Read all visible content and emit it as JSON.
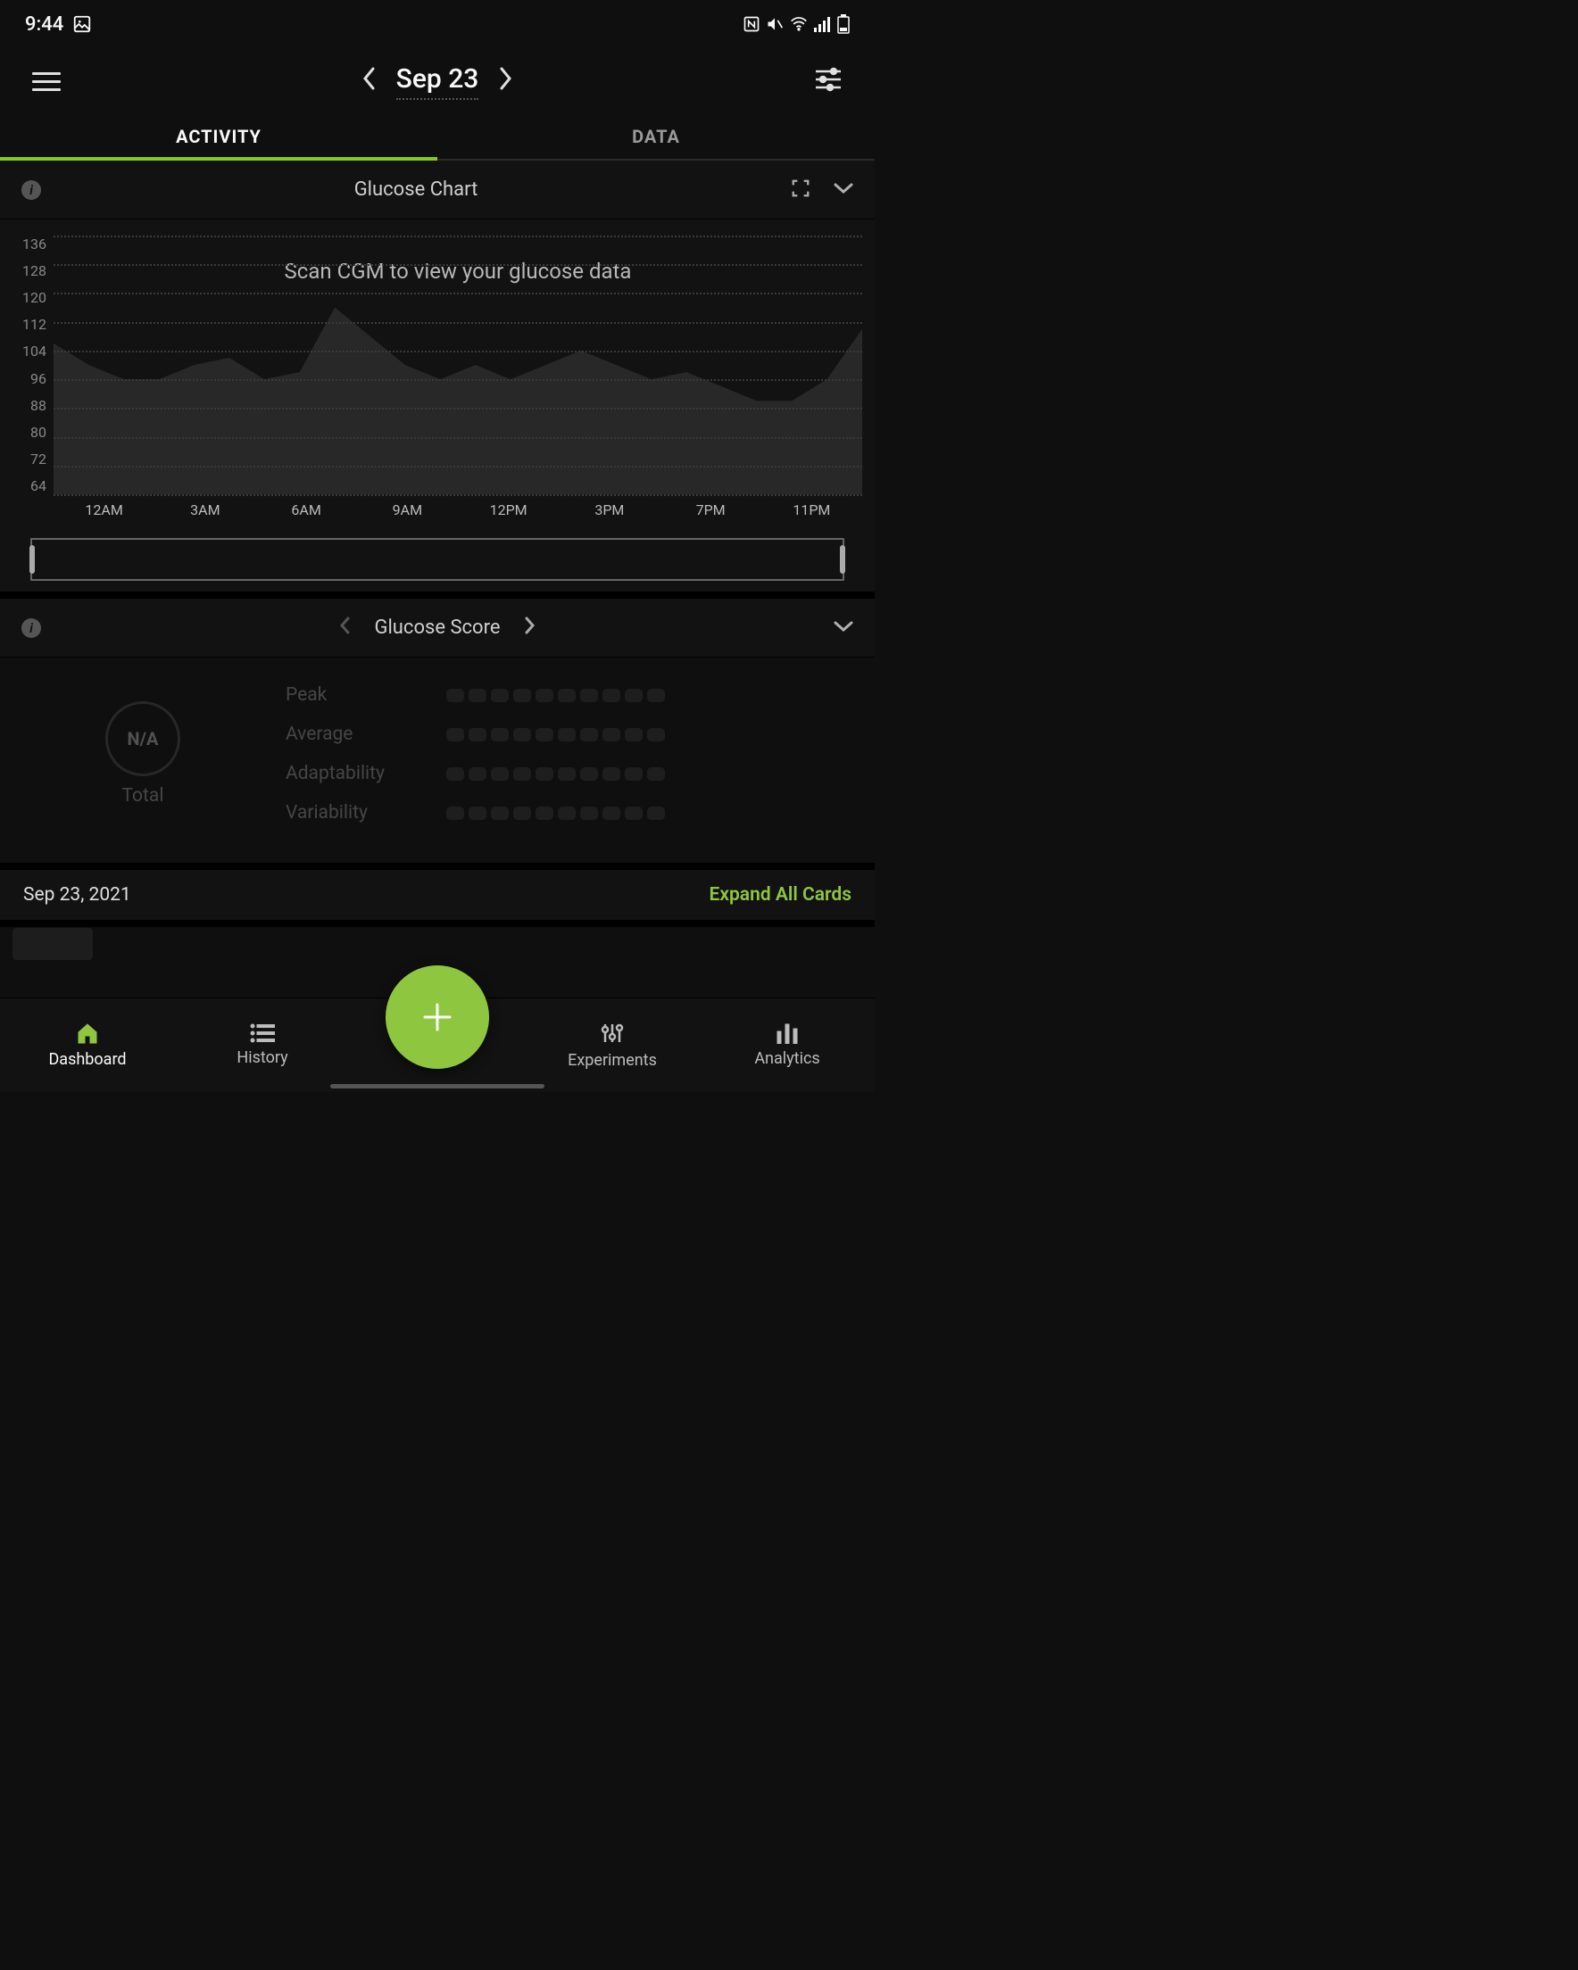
{
  "status": {
    "time": "9:44"
  },
  "header": {
    "date": "Sep 23"
  },
  "tabs": {
    "activity": "ACTIVITY",
    "data": "DATA"
  },
  "glucose_chart": {
    "title": "Glucose Chart",
    "placeholder": "Scan CGM to view your glucose data"
  },
  "glucose_score": {
    "title": "Glucose Score",
    "na": "N/A",
    "total": "Total",
    "metrics": {
      "peak": "Peak",
      "average": "Average",
      "adaptability": "Adaptability",
      "variability": "Variability"
    }
  },
  "date_row": {
    "date": "Sep 23, 2021",
    "expand": "Expand All Cards"
  },
  "nav": {
    "dashboard": "Dashboard",
    "history": "History",
    "experiments": "Experiments",
    "analytics": "Analytics"
  },
  "chart_data": {
    "type": "area",
    "title": "Glucose Chart",
    "ylabel": "",
    "xlabel": "",
    "ylim": [
      64,
      136
    ],
    "y_ticks": [
      136,
      128,
      120,
      112,
      104,
      96,
      88,
      80,
      72,
      64
    ],
    "x_ticks": [
      "12AM",
      "3AM",
      "6AM",
      "9AM",
      "12PM",
      "3PM",
      "7PM",
      "11PM"
    ],
    "note": "Chart shows faded sample/background trace; app indicates no live data (Scan CGM to view your glucose data).",
    "series": [
      {
        "name": "sample-trace",
        "x": [
          0,
          1,
          2,
          3,
          4,
          5,
          6,
          7,
          8,
          9,
          10,
          11,
          12,
          13,
          14,
          15,
          16,
          17,
          18,
          19,
          20,
          21,
          22,
          23
        ],
        "values": [
          106,
          100,
          96,
          96,
          100,
          102,
          96,
          98,
          116,
          108,
          100,
          96,
          100,
          96,
          100,
          104,
          100,
          96,
          98,
          94,
          90,
          90,
          96,
          110
        ]
      }
    ]
  }
}
